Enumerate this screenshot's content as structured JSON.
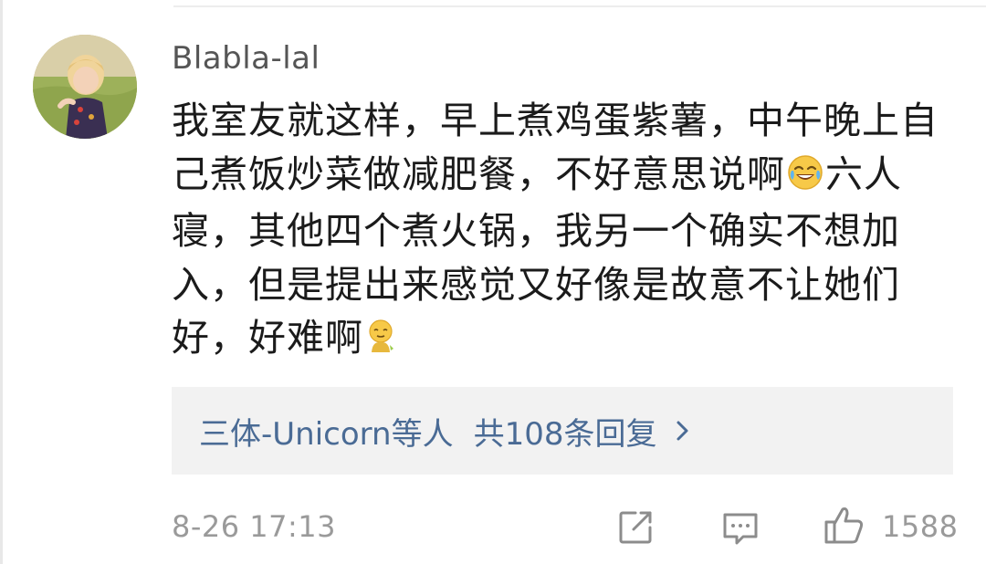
{
  "comment": {
    "username": "Blabla-lal",
    "text_parts": [
      "我室友就这样，早上煮鸡蛋紫薯，中午晚上自己煮饭炒菜做减肥餐，不好意思说啊",
      "六人寝，其他四个煮火锅，我另一个确实不想加入，但是提出来感觉又好像是故意不让她们好，好难啊"
    ],
    "emoji_1": "laugh-cry-emoji",
    "emoji_2": "embarrassed-emoji",
    "replies": {
      "users": "三体-Unicorn等人",
      "count": "共108条回复"
    },
    "timestamp": "8-26 17:13",
    "likes": "1588",
    "icons": {
      "share": "share-icon",
      "reply": "comment-icon",
      "like": "thumbs-up-icon",
      "chevron": "chevron-right-icon"
    }
  }
}
